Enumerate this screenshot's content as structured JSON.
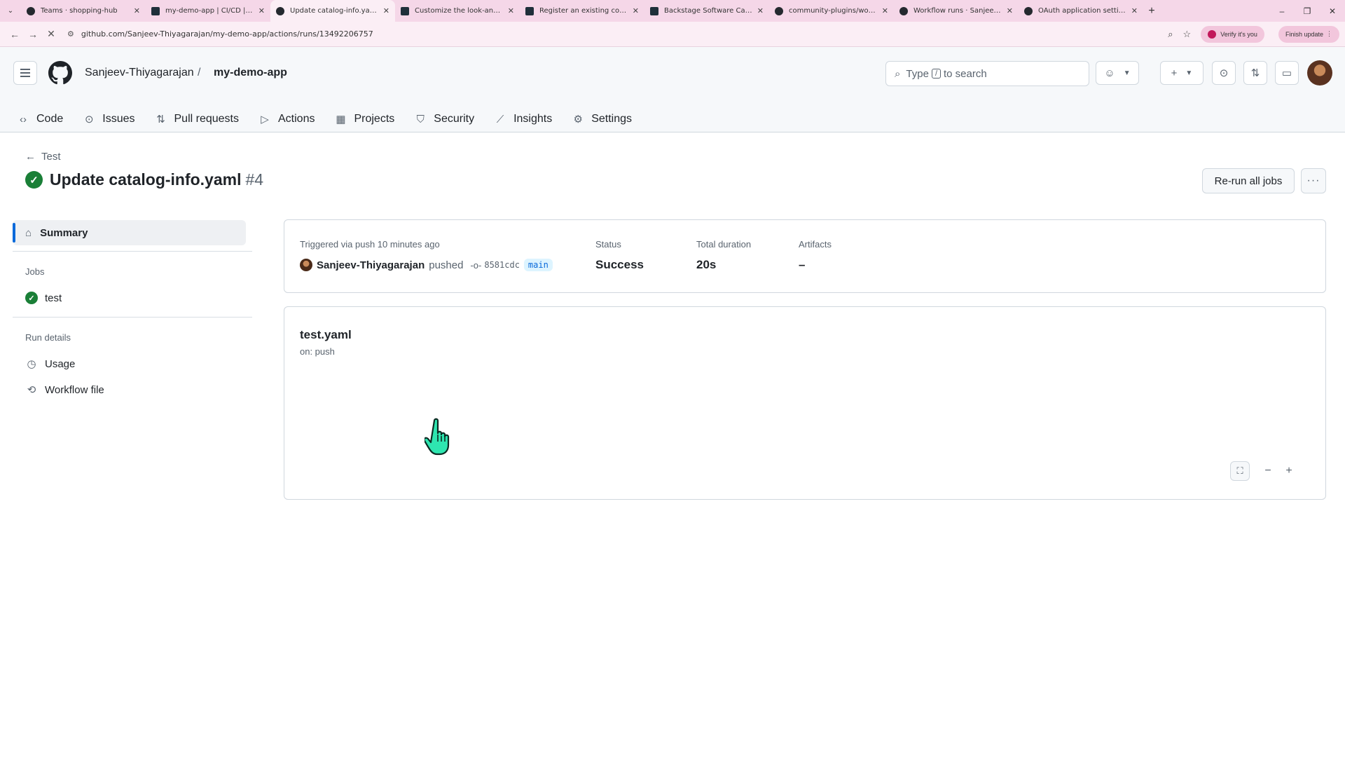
{
  "browser": {
    "tabs": [
      {
        "title": "Teams · shopping-hub",
        "icon": "github-icon"
      },
      {
        "title": "my-demo-app | CI/CD | Scaffolder",
        "icon": "backstage-icon"
      },
      {
        "title": "Update catalog-info.yaml · Sanjeev",
        "icon": "github-icon",
        "active": true
      },
      {
        "title": "Customize the look-and-feel of",
        "icon": "backstage-icon"
      },
      {
        "title": "Register an existing component",
        "icon": "backstage-icon"
      },
      {
        "title": "Backstage Software Catalog and",
        "icon": "backstage-icon"
      },
      {
        "title": "community-plugins/workspaces",
        "icon": "github-icon"
      },
      {
        "title": "Workflow runs · Sanjeev-Thiyagarajan",
        "icon": "github-icon"
      },
      {
        "title": "OAuth application settings",
        "icon": "github-icon"
      }
    ],
    "url": "github.com/Sanjeev-Thiyagarajan/my-demo-app/actions/runs/13492206757",
    "verify_label": "Verify it's you",
    "finish_label": "Finish update"
  },
  "header": {
    "owner": "Sanjeev-Thiyagarajan",
    "separator": "/",
    "repo": "my-demo-app",
    "search_prefix": "Type",
    "search_key": "/",
    "search_suffix": "to search"
  },
  "repo_nav": [
    {
      "label": "Code",
      "icon": "code-icon"
    },
    {
      "label": "Issues",
      "icon": "issue-icon"
    },
    {
      "label": "Pull requests",
      "icon": "pull-request-icon"
    },
    {
      "label": "Actions",
      "icon": "play-icon"
    },
    {
      "label": "Projects",
      "icon": "table-icon"
    },
    {
      "label": "Security",
      "icon": "shield-icon"
    },
    {
      "label": "Insights",
      "icon": "graph-icon"
    },
    {
      "label": "Settings",
      "icon": "gear-icon"
    }
  ],
  "run": {
    "back_label": "Test",
    "title": "Update catalog-info.yaml",
    "number": "#4",
    "rerun_label": "Re-run all jobs",
    "more_label": "···"
  },
  "sidebar": {
    "summary_label": "Summary",
    "jobs_heading": "Jobs",
    "jobs": [
      {
        "label": "test",
        "status": "success"
      }
    ],
    "details_heading": "Run details",
    "details": [
      {
        "label": "Usage",
        "icon": "stopwatch-icon"
      },
      {
        "label": "Workflow file",
        "icon": "file-code-icon"
      }
    ]
  },
  "summary": {
    "trigger_label": "Triggered via push 10 minutes ago",
    "actor": "Sanjeev-Thiyagarajan",
    "action": "pushed",
    "sha": "8581cdc",
    "branch": "main",
    "status_label": "Status",
    "status_value": "Success",
    "duration_label": "Total duration",
    "duration_value": "20s",
    "artifacts_label": "Artifacts",
    "artifacts_value": "–"
  },
  "workflow": {
    "file": "test.yaml",
    "trigger": "on: push"
  },
  "colors": {
    "success": "#1a7f37",
    "accent": "#0969da",
    "tabbar": "#f5d7e8"
  }
}
